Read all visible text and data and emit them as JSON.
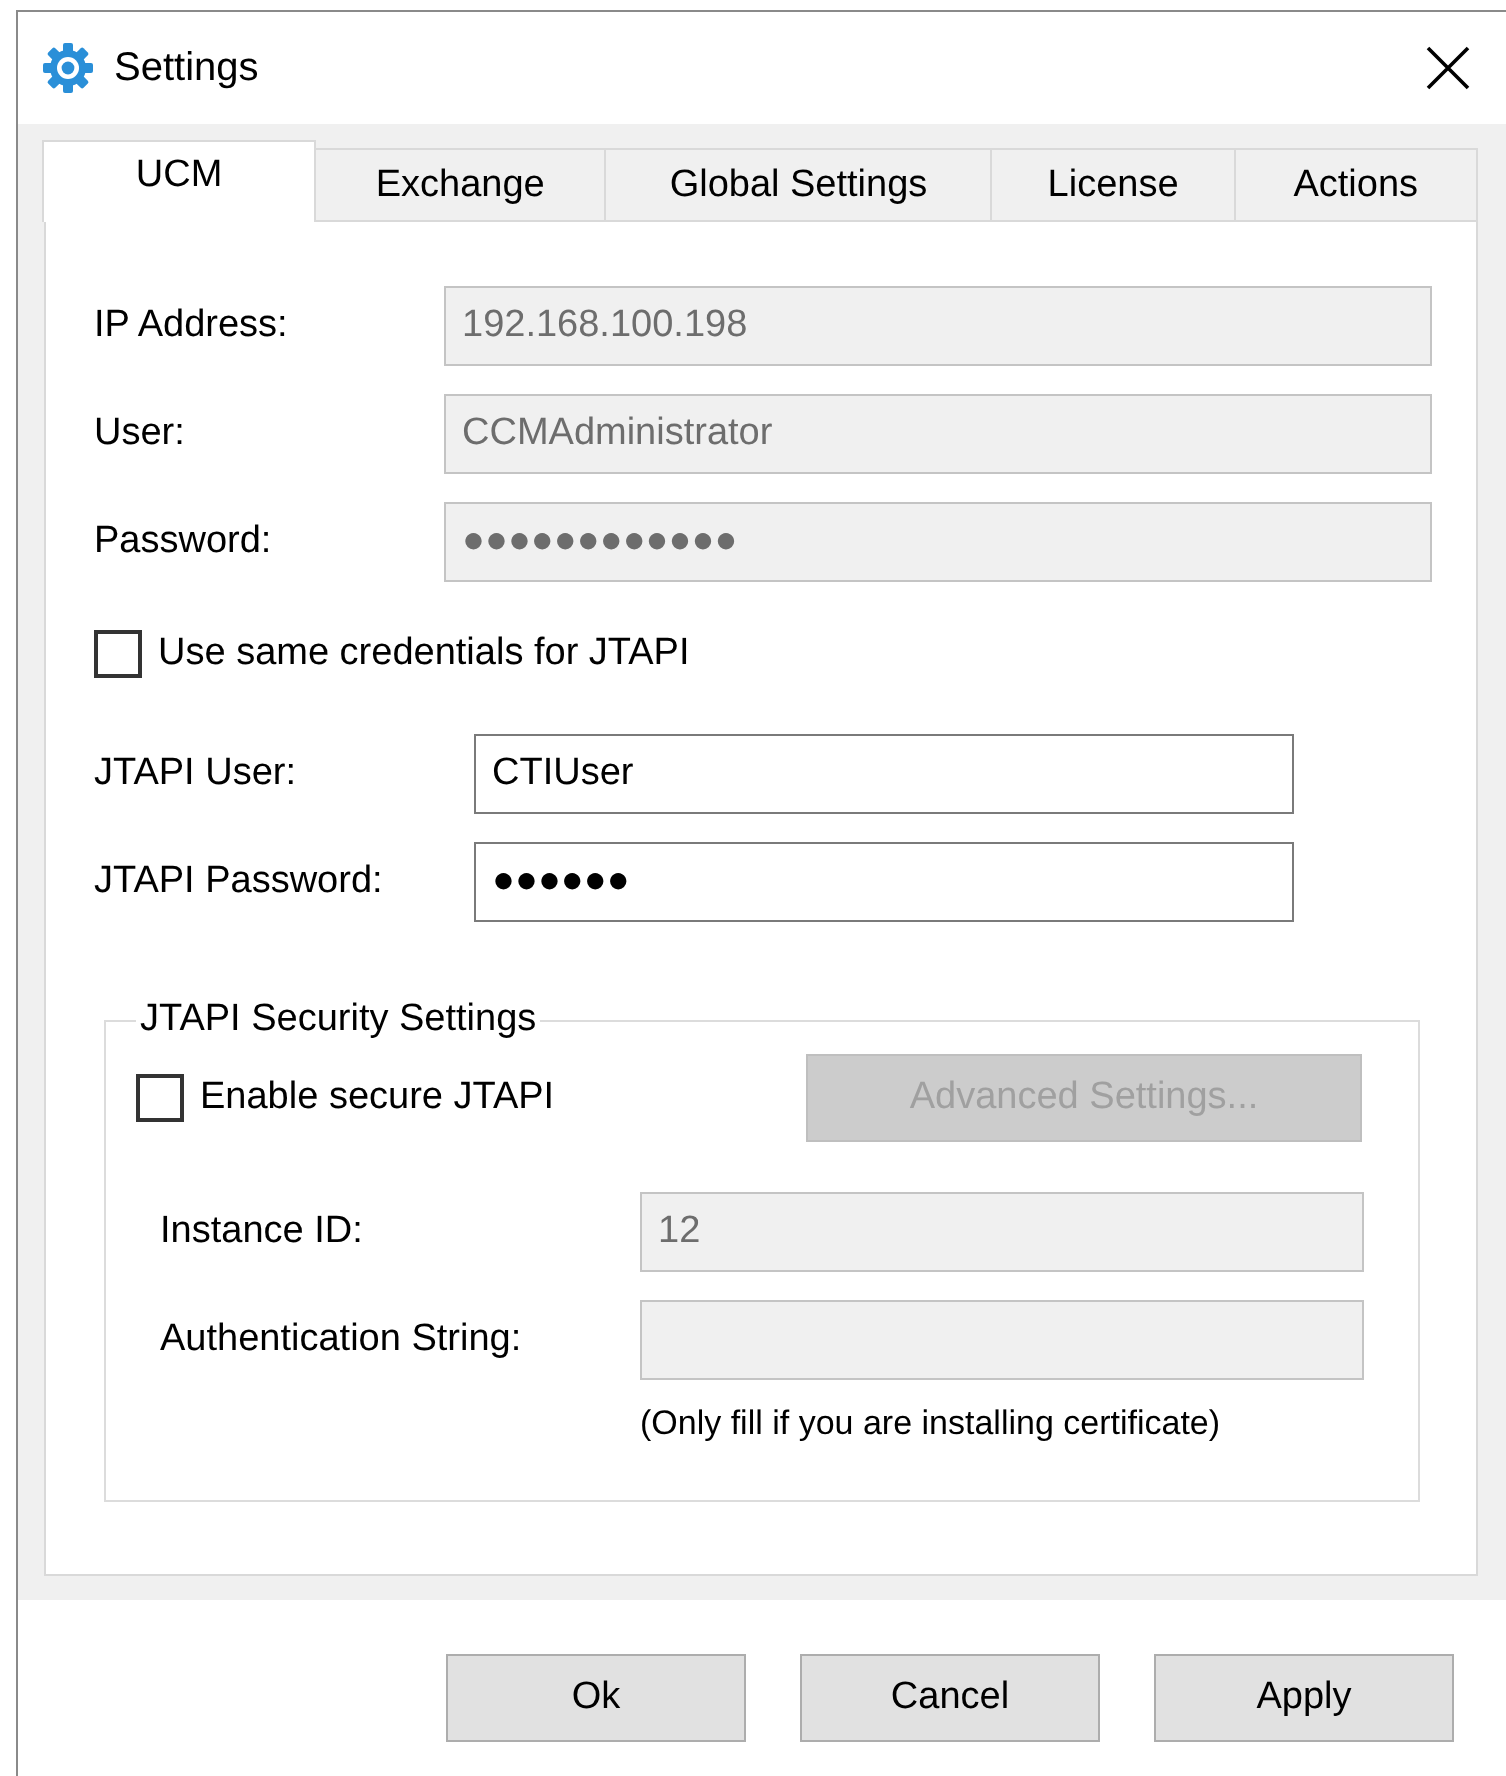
{
  "window": {
    "title": "Settings"
  },
  "tabs": [
    {
      "label": "UCM",
      "selected": true
    },
    {
      "label": "Exchange",
      "selected": false
    },
    {
      "label": "Global Settings",
      "selected": false
    },
    {
      "label": "License",
      "selected": false
    },
    {
      "label": "Actions",
      "selected": false
    }
  ],
  "ucm_fields": [
    {
      "label": "IP Address:",
      "value": "192.168.100.198",
      "disabled": true
    },
    {
      "label": "User:",
      "value": "CCMAdministrator",
      "disabled": true
    },
    {
      "label": "Password:",
      "value": "●●●●●●●●●●●●",
      "disabled": true
    }
  ],
  "same_credentials": {
    "label": "Use same credentials for JTAPI",
    "checked": false
  },
  "jtapi_fields": [
    {
      "label": "JTAPI User:",
      "value": "CTIUser",
      "disabled": false
    },
    {
      "label": "JTAPI Password:",
      "value": "●●●●●●",
      "disabled": false
    }
  ],
  "security": {
    "title": "JTAPI Security Settings",
    "enable_secure": {
      "label": "Enable secure JTAPI",
      "checked": false
    },
    "advanced_button": {
      "label": "Advanced Settings...",
      "disabled": true
    },
    "fields": [
      {
        "label": "Instance ID:",
        "value": "12",
        "disabled": true
      },
      {
        "label": "Authentication String:",
        "disabled": true
      }
    ],
    "note": "(Only fill if you are installing certificate)"
  },
  "buttons": [
    {
      "label": "Ok"
    },
    {
      "label": "Cancel"
    },
    {
      "label": "Apply"
    }
  ]
}
